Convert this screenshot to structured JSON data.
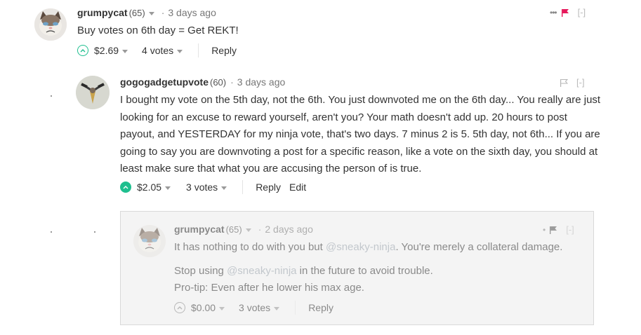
{
  "comments": [
    {
      "author": "grumpycat",
      "reputation": "(65)",
      "time": "3 days ago",
      "body": [
        "Buy votes on 6th day = Get REKT!"
      ],
      "payout": "$2.69",
      "votes": "4 votes",
      "reply_label": "Reply",
      "collapse_label": "[-]",
      "flag_color": "#e6185b"
    },
    {
      "author": "gogogadgetupvote",
      "reputation": "(60)",
      "time": "3 days ago",
      "body": [
        "I bought my vote on the 5th day, not the 6th. You just downvoted me on the 6th day... You really are just looking for an excuse to reward yourself, aren't you? Your math doesn't add up. 20 hours to post payout, and YESTERDAY for my ninja vote, that's two days. 7 minus 2 is 5. 5th day, not 6th... If you are going to say you are downvoting a post for a specific reason, like a vote on the sixth day, you should at least make sure that what you are accusing the person of is true."
      ],
      "payout": "$2.05",
      "votes": "3 votes",
      "reply_label": "Reply",
      "edit_label": "Edit",
      "collapse_label": "[-]"
    },
    {
      "author": "grumpycat",
      "reputation": "(65)",
      "time": "2 days ago",
      "line1_pre": "It has nothing to do with you but ",
      "line1_mention": "@sneaky-ninja",
      "line1_post": ". You're merely a collateral damage.",
      "line2_pre": "Stop using ",
      "line2_mention": "@sneaky-ninja",
      "line2_post": " in the future to avoid trouble.",
      "line3": "Pro-tip: Even after he lower his max age.",
      "payout": "$0.00",
      "votes": "3 votes",
      "reply_label": "Reply",
      "collapse_label": "[-]"
    }
  ],
  "colors": {
    "upvote": "#1fbf8f",
    "flag": "#e6185b"
  }
}
